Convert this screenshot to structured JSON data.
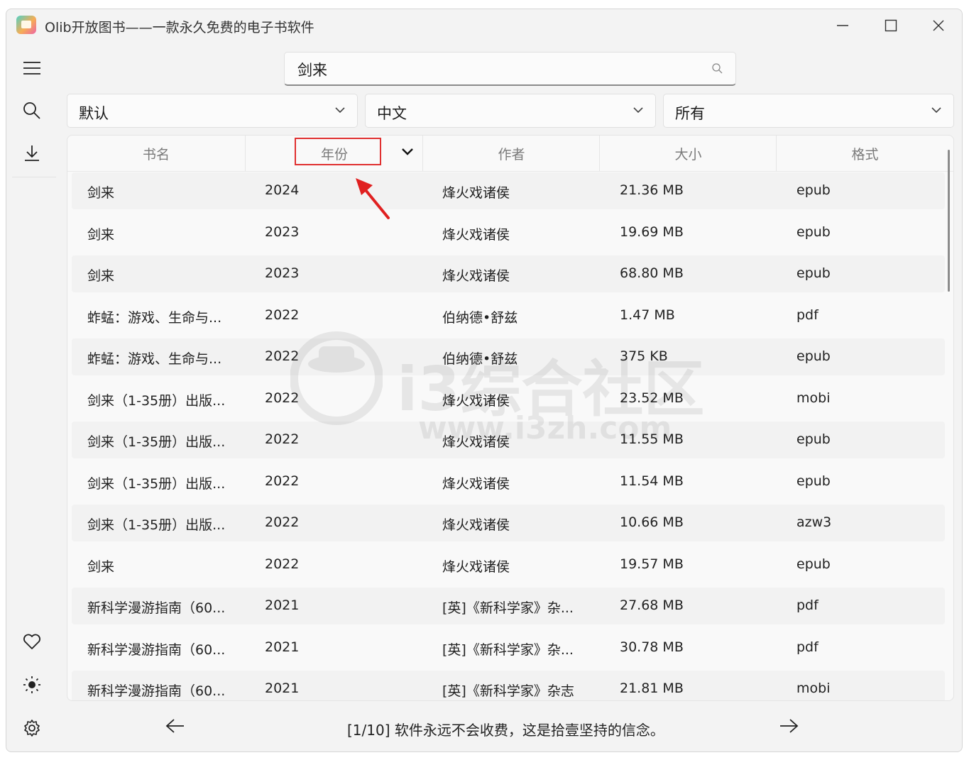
{
  "window": {
    "title": "Olib开放图书——一款永久免费的电子书软件"
  },
  "search": {
    "value": "剑来"
  },
  "filters": [
    {
      "value": "默认"
    },
    {
      "value": "中文"
    },
    {
      "value": "所有"
    }
  ],
  "table": {
    "columns": [
      "书名",
      "年份",
      "作者",
      "大小",
      "格式"
    ],
    "rows": [
      [
        "剑来",
        "2024",
        "烽火戏诸侯",
        "21.36 MB",
        "epub"
      ],
      [
        "剑来",
        "2023",
        "烽火戏诸侯",
        "19.69 MB",
        "epub"
      ],
      [
        "剑来",
        "2023",
        "烽火戏诸侯",
        "68.80 MB",
        "epub"
      ],
      [
        "蚱蜢：游戏、生命与...",
        "2022",
        "伯纳德•舒兹",
        "1.47 MB",
        "pdf"
      ],
      [
        "蚱蜢：游戏、生命与...",
        "2022",
        "伯纳德•舒兹",
        "375 KB",
        "epub"
      ],
      [
        "剑来（1-35册）出版...",
        "2022",
        "烽火戏诸侯",
        "23.52 MB",
        "mobi"
      ],
      [
        "剑来（1-35册）出版...",
        "2022",
        "烽火戏诸侯",
        "11.55 MB",
        "epub"
      ],
      [
        "剑来（1-35册）出版...",
        "2022",
        "烽火戏诸侯",
        "11.54 MB",
        "epub"
      ],
      [
        "剑来（1-35册）出版...",
        "2022",
        "烽火戏诸侯",
        "10.66 MB",
        "azw3"
      ],
      [
        "剑来",
        "2022",
        "烽火戏诸侯",
        "19.57 MB",
        "epub"
      ],
      [
        "新科学漫游指南（60...",
        "2021",
        "[英]《新科学家》杂...",
        "27.68 MB",
        "pdf"
      ],
      [
        "新科学漫游指南（60...",
        "2021",
        "[英]《新科学家》杂...",
        "30.78 MB",
        "pdf"
      ],
      [
        "新科学漫游指南（60...",
        "2021",
        "[英]《新科学家》杂志",
        "21.81 MB",
        "mobi"
      ]
    ]
  },
  "footer": {
    "status": "[1/10] 软件永远不会收费，这是拾壹坚持的信念。"
  },
  "watermark": {
    "line1": "i3综合社区",
    "line2": "www.i3zh.com"
  },
  "colors": {
    "highlight_box": "#e03030",
    "arrow": "#e02020"
  },
  "icons": {
    "sidebar": [
      "menu-icon",
      "search-icon",
      "download-icon",
      "heart-icon",
      "brightness-icon",
      "settings-icon"
    ],
    "window_controls": [
      "minimize-icon",
      "maximize-icon",
      "close-icon"
    ]
  }
}
